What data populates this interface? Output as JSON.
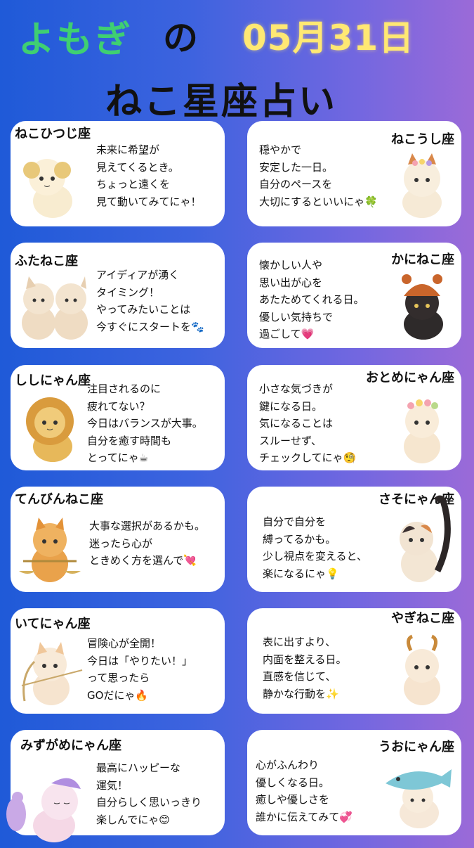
{
  "header": {
    "brand": "よもぎ",
    "no": "の",
    "date": "05月31日",
    "title": "ねこ星座占い"
  },
  "colors": {
    "brand": "#3fcf72",
    "date": "#ffe873",
    "card": "#ffffff"
  },
  "cards": [
    {
      "name": "ねこひつじ座",
      "lines": [
        "未来に希望が",
        "見えてくるとき。",
        "ちょっと遠くを",
        "見て動いてみてにゃ！"
      ]
    },
    {
      "name": "ねこうし座",
      "lines": [
        "穏やかで",
        "安定した一日。",
        "自分のペースを",
        "大切にするといいにゃ🍀"
      ]
    },
    {
      "name": "ふたねこ座",
      "lines": [
        "アイディアが湧く",
        "タイミング！",
        "やってみたいことは",
        "今すぐにスタートを🐾"
      ]
    },
    {
      "name": "かにねこ座",
      "lines": [
        "懐かしい人や",
        "思い出が心を",
        "あたためてくれる日。",
        "優しい気持ちで",
        "過ごして💗"
      ]
    },
    {
      "name": "ししにゃん座",
      "lines": [
        "注目されるのに",
        "疲れてない？",
        "今日はバランスが大事。",
        "自分を癒す時間も",
        "とってにゃ☕"
      ]
    },
    {
      "name": "おとめにゃん座",
      "lines": [
        "小さな気づきが",
        "鍵になる日。",
        "気になることは",
        "スルーせず、",
        "チェックしてにゃ🧐"
      ]
    },
    {
      "name": "てんびんねこ座",
      "lines": [
        "大事な選択があるかも。",
        "迷ったら心が",
        "ときめく方を選んで💘"
      ]
    },
    {
      "name": "さそにゃん座",
      "lines": [
        "自分で自分を",
        "縛ってるかも。",
        "少し視点を変えると、",
        "楽になるにゃ💡"
      ]
    },
    {
      "name": "いてにゃん座",
      "lines": [
        "冒険心が全開！",
        "今日は「やりたい！」",
        "って思ったら",
        "GOだにゃ🔥"
      ]
    },
    {
      "name": "やぎねこ座",
      "lines": [
        "表に出すより、",
        "内面を整える日。",
        "直感を信じて、",
        "静かな行動を✨"
      ]
    },
    {
      "name": "みずがめにゃん座",
      "lines": [
        "最高にハッピーな",
        "運気！",
        "自分らしく思いっきり",
        "楽しんでにゃ😊"
      ]
    },
    {
      "name": "うおにゃん座",
      "lines": [
        "心がふんわり",
        "優しくなる日。",
        "癒しや優しさを",
        "誰かに伝えてみて💞"
      ]
    }
  ]
}
